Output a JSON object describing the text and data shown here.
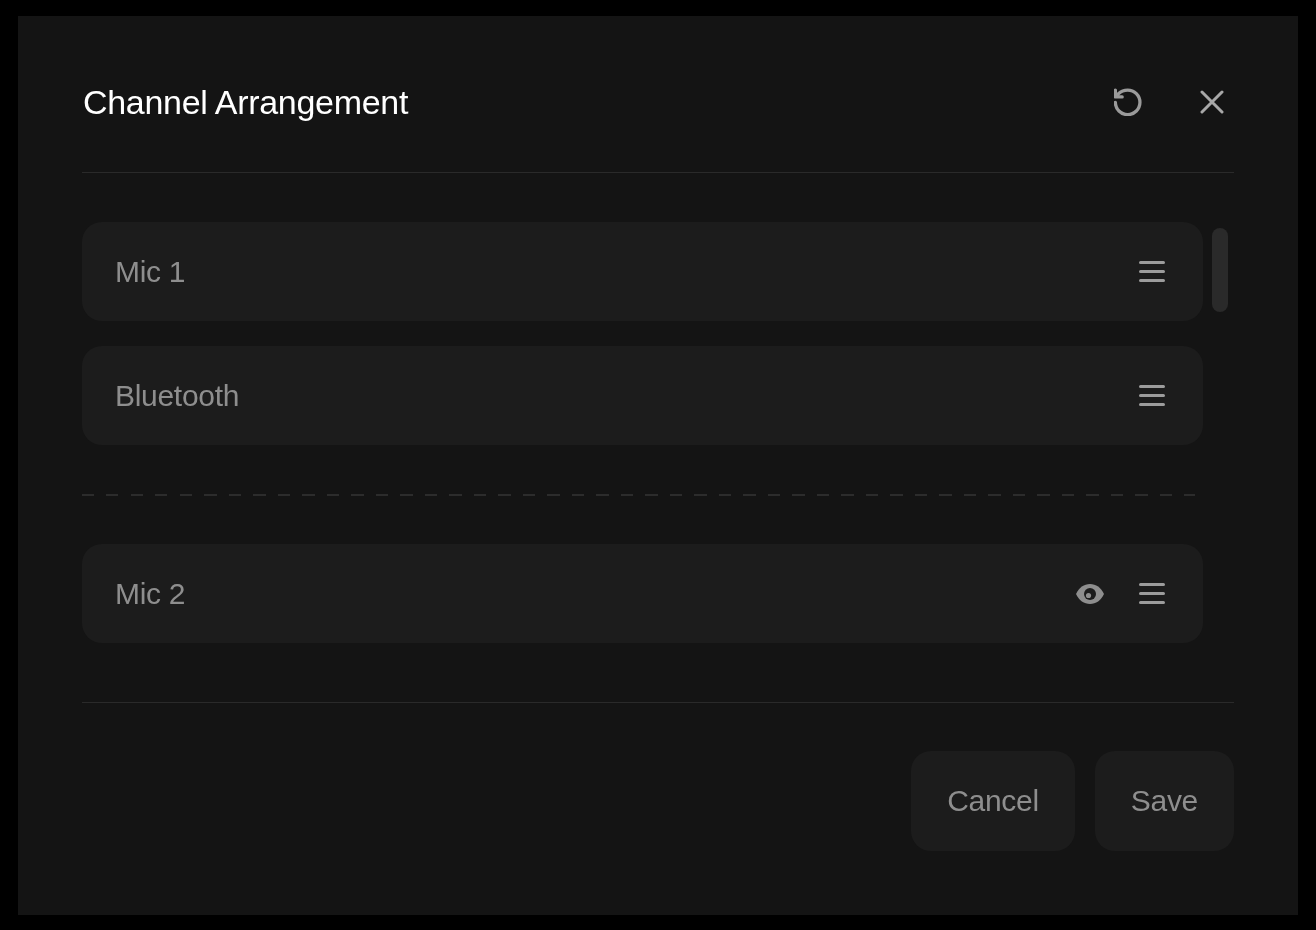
{
  "dialog": {
    "title": "Channel Arrangement"
  },
  "channel_groups": [
    {
      "channels": [
        {
          "name": "Mic 1",
          "kind": "plain"
        },
        {
          "name": "Bluetooth",
          "kind": "plain"
        }
      ]
    },
    {
      "channels": [
        {
          "name": "Mic 2",
          "kind": "visibility"
        }
      ]
    }
  ],
  "buttons": [
    "Cancel",
    "Save"
  ]
}
